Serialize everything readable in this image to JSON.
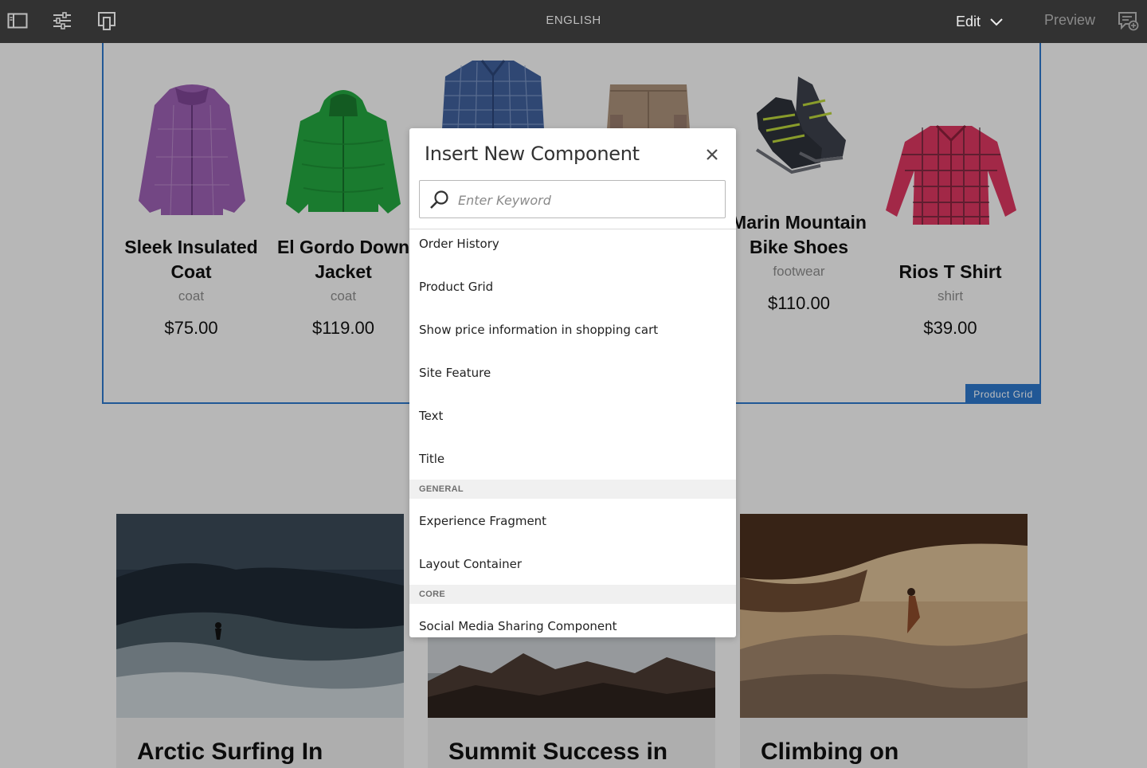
{
  "toolbar": {
    "language": "ENGLISH",
    "mode_label": "Edit",
    "preview_label": "Preview"
  },
  "product_grid": {
    "badge": "Product Grid",
    "products": [
      {
        "name": "Sleek Insulated Coat",
        "category": "coat",
        "price": "$75.00"
      },
      {
        "name": "El Gordo Down Jacket",
        "category": "coat",
        "price": "$119.00"
      },
      {
        "name": "Marin Mountain Bike Shoes",
        "category": "footwear",
        "price": "$110.00"
      },
      {
        "name": "Rios T Shirt",
        "category": "shirt",
        "price": "$39.00"
      }
    ]
  },
  "articles": [
    {
      "title": "Arctic Surfing In"
    },
    {
      "title": "Summit Success in"
    },
    {
      "title": "Climbing on"
    }
  ],
  "dialog": {
    "title": "Insert New Component",
    "search_placeholder": "Enter Keyword",
    "items": [
      {
        "label": "Order History"
      },
      {
        "label": "Product Grid"
      },
      {
        "label": "Show price information in shopping cart"
      },
      {
        "label": "Site Feature"
      },
      {
        "label": "Text"
      },
      {
        "label": "Title"
      }
    ],
    "group_general": "GENERAL",
    "general_items": [
      {
        "label": "Experience Fragment"
      },
      {
        "label": "Layout Container"
      }
    ],
    "group_core": "CORE",
    "core_items": [
      {
        "label": "Social Media Sharing Component"
      }
    ]
  }
}
